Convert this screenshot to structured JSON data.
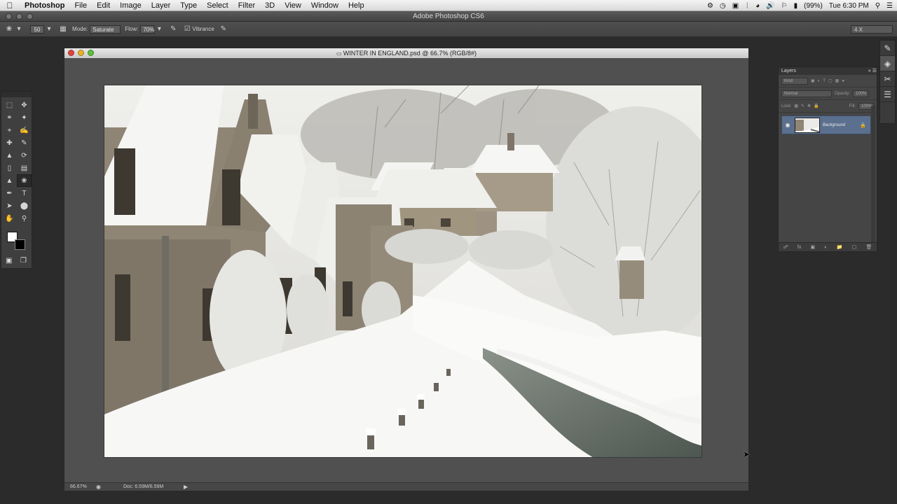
{
  "menubar": {
    "items": [
      "Photoshop",
      "File",
      "Edit",
      "Image",
      "Layer",
      "Type",
      "Select",
      "Filter",
      "3D",
      "View",
      "Window",
      "Help"
    ],
    "battery": "(99%)",
    "clock": "Tue 6:30 PM"
  },
  "app": {
    "title": "Adobe Photoshop CS6"
  },
  "options": {
    "brush_size": "50",
    "mode_label": "Mode:",
    "mode_value": "Saturate",
    "flow_label": "Flow:",
    "flow_value": "70%",
    "vibrance_label": "Vibrance",
    "workspace_value": "4 X"
  },
  "document": {
    "title": "WINTER IN ENGLAND.psd @ 66.7% (RGB/8#)",
    "zoom": "66.67%",
    "doc_size": "Doc: 6.59M/6.59M"
  },
  "layers": {
    "tab": "Layers",
    "kind": "Kind",
    "blend": "Normal",
    "opacity_label": "Opacity:",
    "opacity_value": "100%",
    "lock_label": "Lock:",
    "fill_label": "Fill:",
    "fill_value": "100%",
    "layer_name": "Background"
  }
}
